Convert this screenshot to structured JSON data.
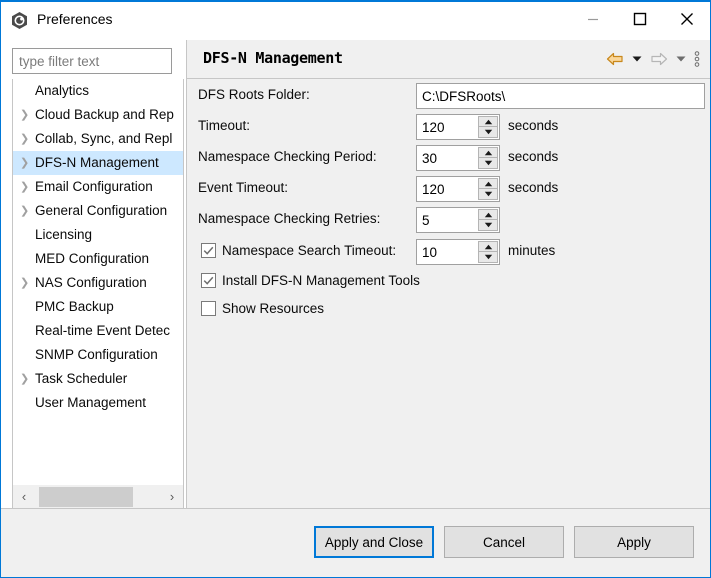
{
  "window": {
    "title": "Preferences",
    "icon": "preferences-app-icon",
    "controls": {
      "minimize": "minimize-icon",
      "maximize": "maximize-icon",
      "close": "close-icon"
    }
  },
  "filter": {
    "placeholder": "type filter text",
    "value": ""
  },
  "tree": {
    "items": [
      {
        "label": "Analytics",
        "expandable": false,
        "selected": false
      },
      {
        "label": "Cloud Backup and Rep",
        "expandable": true,
        "selected": false
      },
      {
        "label": "Collab, Sync, and Repl",
        "expandable": true,
        "selected": false
      },
      {
        "label": "DFS-N Management",
        "expandable": true,
        "selected": true
      },
      {
        "label": "Email Configuration",
        "expandable": true,
        "selected": false
      },
      {
        "label": "General Configuration",
        "expandable": true,
        "selected": false
      },
      {
        "label": "Licensing",
        "expandable": false,
        "selected": false
      },
      {
        "label": "MED Configuration",
        "expandable": false,
        "selected": false
      },
      {
        "label": "NAS Configuration",
        "expandable": true,
        "selected": false
      },
      {
        "label": "PMC Backup",
        "expandable": false,
        "selected": false
      },
      {
        "label": "Real-time Event Detec",
        "expandable": false,
        "selected": false
      },
      {
        "label": "SNMP Configuration",
        "expandable": false,
        "selected": false
      },
      {
        "label": "Task Scheduler",
        "expandable": true,
        "selected": false
      },
      {
        "label": "User Management",
        "expandable": false,
        "selected": false
      }
    ],
    "scrollbar": {
      "left_arrow": "‹",
      "right_arrow": "›"
    }
  },
  "content": {
    "title": "DFS-N Management",
    "nav": {
      "back": "back-arrow-icon",
      "back_menu": "back-dropdown-icon",
      "forward": "forward-arrow-icon",
      "forward_menu": "forward-dropdown-icon",
      "menu": "view-menu-icon"
    },
    "fields": [
      {
        "label": "DFS Roots Folder:",
        "type": "text",
        "value": "C:\\DFSRoots\\",
        "unit": ""
      },
      {
        "label": "Timeout:",
        "type": "spinner",
        "value": "120",
        "unit": "seconds"
      },
      {
        "label": "Namespace Checking Period:",
        "type": "spinner",
        "value": "30",
        "unit": "seconds"
      },
      {
        "label": "Event Timeout:",
        "type": "spinner",
        "value": "120",
        "unit": "seconds"
      },
      {
        "label": "Namespace Checking Retries:",
        "type": "spinner",
        "value": "5",
        "unit": ""
      }
    ],
    "checkbox_spinner": {
      "label": "Namespace Search Timeout:",
      "checked": true,
      "value": "10",
      "unit": "minutes"
    },
    "checkboxes": [
      {
        "label": "Install DFS-N Management Tools",
        "checked": true
      },
      {
        "label": "Show Resources",
        "checked": false
      }
    ]
  },
  "buttons": {
    "apply_and_close": "Apply and Close",
    "cancel": "Cancel",
    "apply": "Apply"
  },
  "colors": {
    "accent": "#0078d7",
    "selection": "#cde8ff",
    "panel": "#f0f0f0",
    "back_arrow": "#e8a33d"
  }
}
